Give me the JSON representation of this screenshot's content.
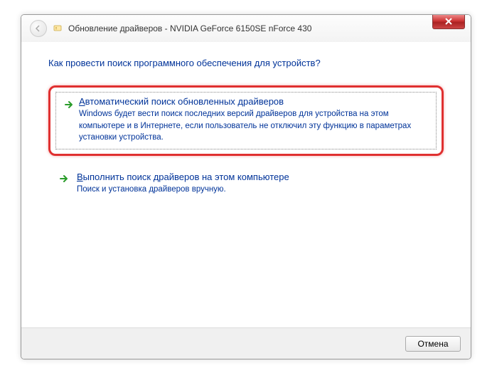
{
  "titlebar": {
    "title": "Обновление драйверов - NVIDIA GeForce 6150SE nForce 430"
  },
  "content": {
    "question": "Как провести поиск программного обеспечения для устройств?"
  },
  "options": [
    {
      "title": "Автоматический поиск обновленных драйверов",
      "desc": "Windows будет вести поиск последних версий драйверов для устройства на этом компьютере и в Интернете, если пользователь не отключил эту функцию в параметрах установки устройства."
    },
    {
      "title": "Выполнить поиск драйверов на этом компьютере",
      "desc": "Поиск и установка драйверов вручную."
    }
  ],
  "footer": {
    "cancel": "Отмена"
  },
  "colors": {
    "link": "#003399",
    "highlight": "#e03030"
  }
}
